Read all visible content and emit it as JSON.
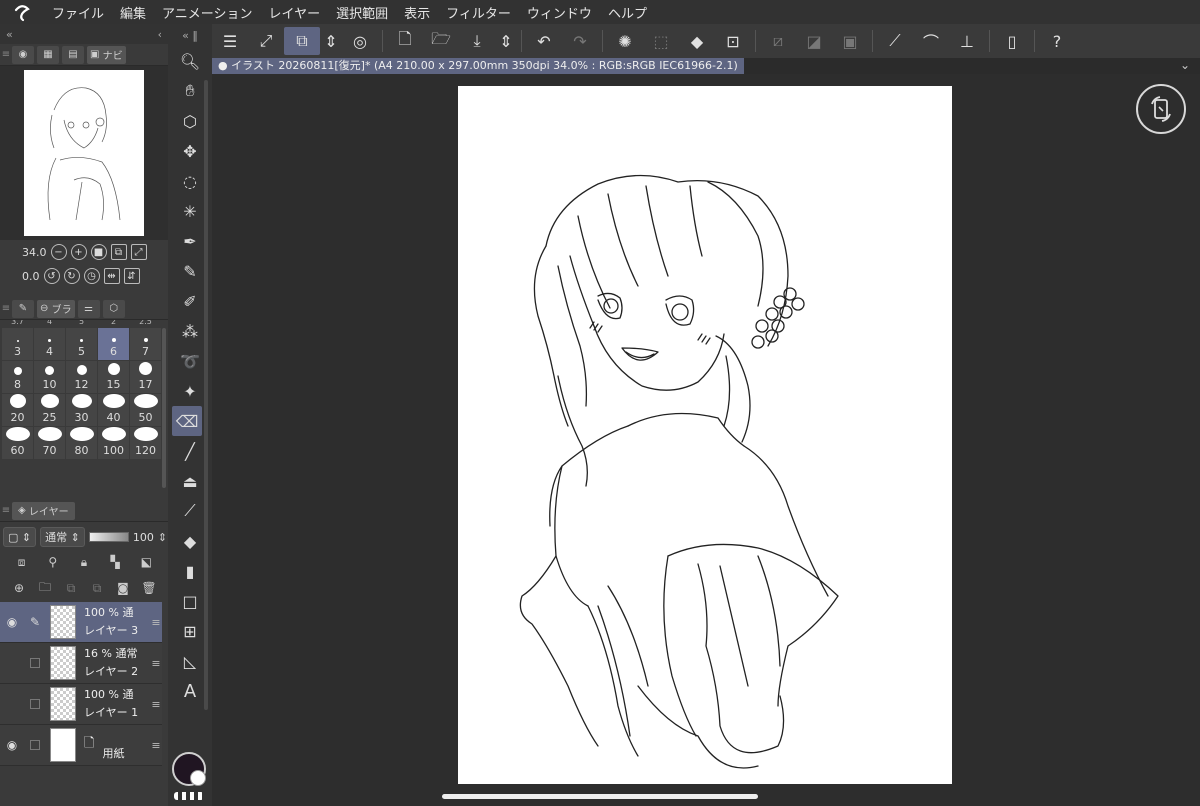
{
  "menu": {
    "items": [
      "ファイル",
      "編集",
      "アニメーション",
      "レイヤー",
      "選択範囲",
      "表示",
      "フィルター",
      "ウィンドウ",
      "ヘルプ"
    ]
  },
  "navigator": {
    "tab_label": "ナビ",
    "zoom": "34.0",
    "rotation": "0.0"
  },
  "brush": {
    "tab_label": "ブラ",
    "top_partial": [
      "3.7",
      "4",
      "5",
      "2",
      "2.5"
    ],
    "sizes": [
      "3",
      "4",
      "5",
      "6",
      "7",
      "8",
      "10",
      "12",
      "15",
      "17",
      "20",
      "25",
      "30",
      "40",
      "50",
      "60",
      "70",
      "80",
      "100",
      "120"
    ],
    "selected": "6"
  },
  "layer_panel": {
    "tab_label": "レイヤー",
    "blend_mode": "通常",
    "opacity": "100",
    "layers": [
      {
        "opacity": "100 %",
        "mode": "通",
        "name": "レイヤー 3",
        "visible": true,
        "selected": true
      },
      {
        "opacity": "16 %",
        "mode": "通常",
        "name": "レイヤー 2",
        "visible": false,
        "selected": false
      },
      {
        "opacity": "100 %",
        "mode": "通",
        "name": "レイヤー 1",
        "visible": false,
        "selected": false
      },
      {
        "opacity": "",
        "mode": "",
        "name": "用紙",
        "visible": true,
        "selected": false
      }
    ]
  },
  "canvas": {
    "tab_title": "イラスト 20260811[復元]* (A4 210.00 x 297.00mm 350dpi 34.0% : RGB:sRGB IEC61966-2.1)"
  },
  "tool_text_glyph": "A"
}
